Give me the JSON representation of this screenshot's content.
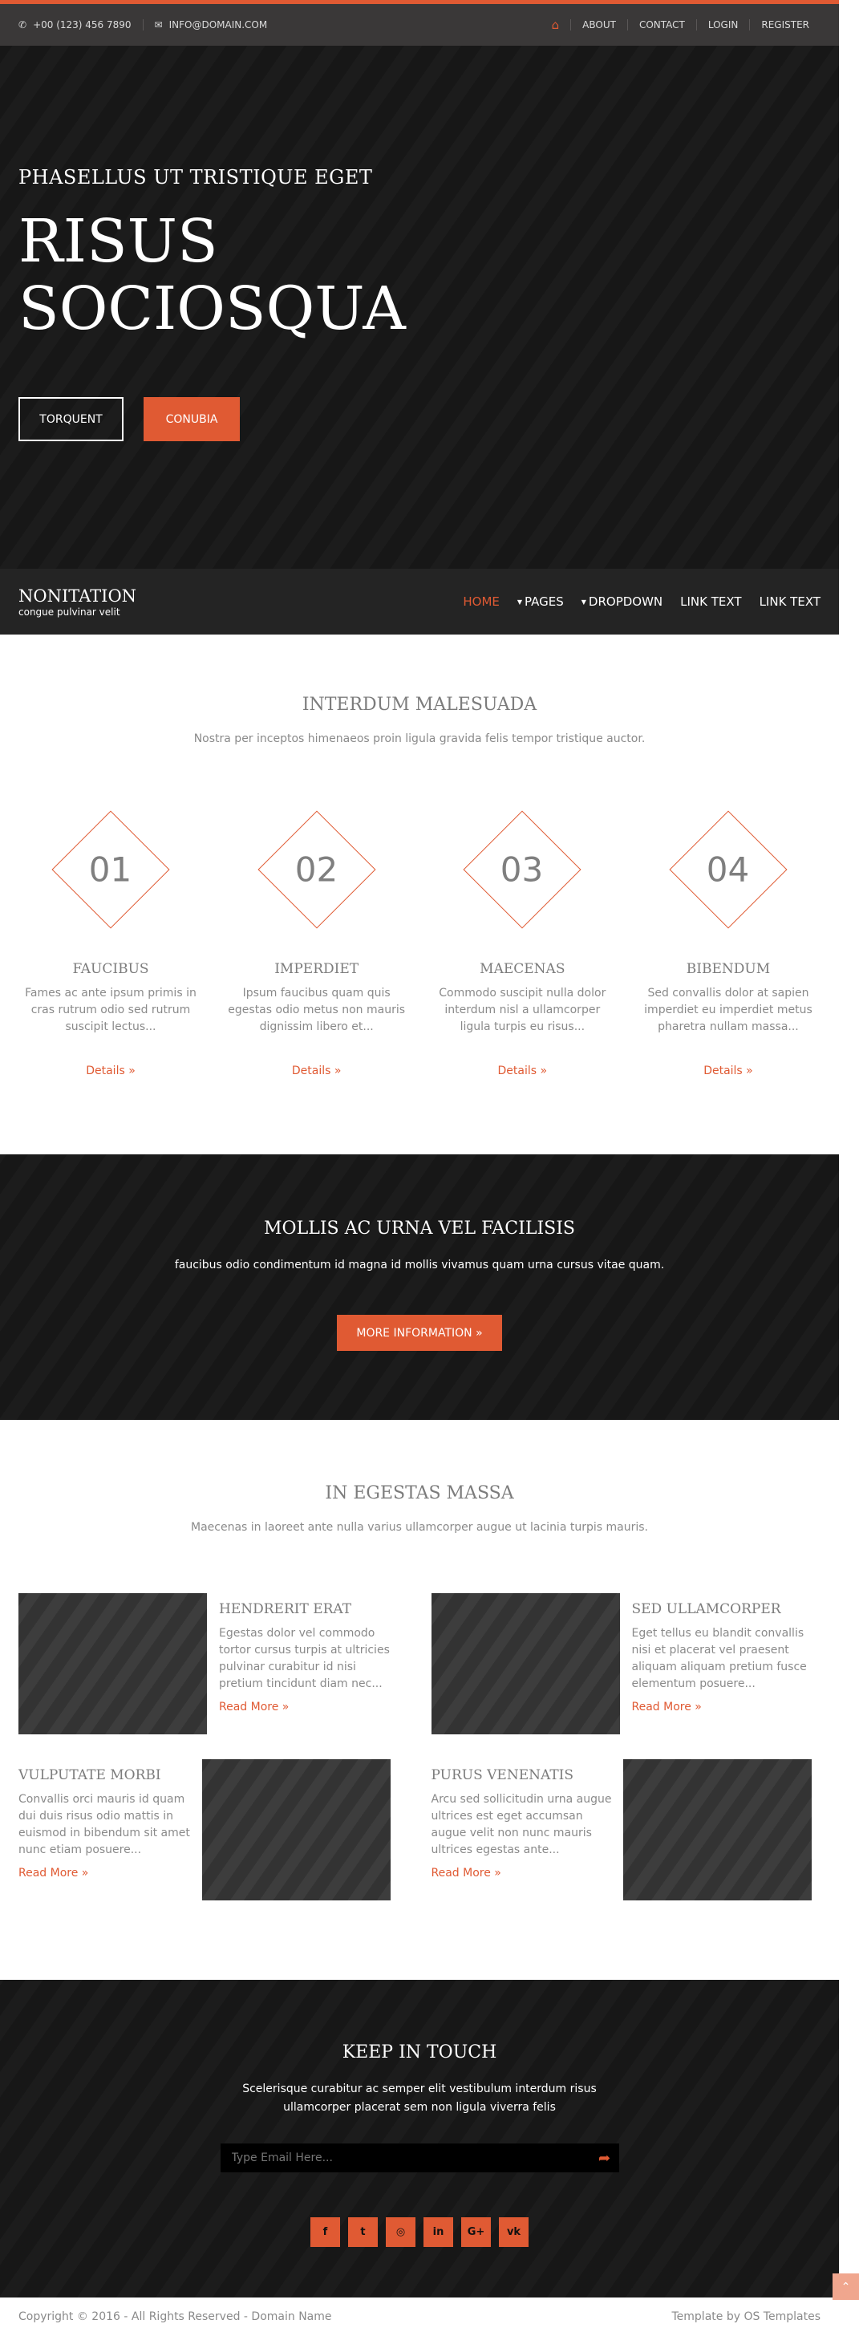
{
  "colors": {
    "accent": "#e05a33",
    "dark": "#171717",
    "topbar": "#3a3838",
    "navbar": "#242424"
  },
  "topbar": {
    "phone_icon": "phone-icon",
    "phone": "+00 (123) 456 7890",
    "email_icon": "envelope-icon",
    "email": "INFO@DOMAIN.COM",
    "home_icon": "home-icon",
    "links": [
      "ABOUT",
      "CONTACT",
      "LOGIN",
      "REGISTER"
    ]
  },
  "hero": {
    "subtitle": "PHASELLUS UT TRISTIQUE EGET",
    "title_line1": "RISUS",
    "title_line2": "SOCIOSQUA",
    "btn_primary": "TORQUENT",
    "btn_secondary": "CONUBIA"
  },
  "navbar": {
    "brand": "NONITATION",
    "tagline": "congue pulvinar velit",
    "items": [
      "HOME",
      "PAGES",
      "DROPDOWN",
      "LINK TEXT",
      "LINK TEXT"
    ]
  },
  "features": {
    "title": "INTERDUM MALESUADA",
    "subtitle": "Nostra per inceptos himenaeos proin ligula gravida felis tempor tristique auctor.",
    "items": [
      {
        "num": "01",
        "title": "FAUCIBUS",
        "l1": "Fames ac ante ipsum primis in",
        "l2": "cras rutrum odio sed rutrum",
        "l3": "suscipit lectus...",
        "link": "Details »"
      },
      {
        "num": "02",
        "title": "IMPERDIET",
        "l1": "Ipsum faucibus quam quis",
        "l2": "egestas odio metus non mauris",
        "l3": "dignissim libero et...",
        "link": "Details »"
      },
      {
        "num": "03",
        "title": "MAECENAS",
        "l1": "Commodo suscipit nulla dolor",
        "l2": "interdum nisl a ullamcorper",
        "l3": "ligula turpis eu risus...",
        "link": "Details »"
      },
      {
        "num": "04",
        "title": "BIBENDUM",
        "l1": "Sed convallis dolor at sapien",
        "l2": "imperdiet eu imperdiet metus",
        "l3": "pharetra nullam massa...",
        "link": "Details »"
      }
    ]
  },
  "cta": {
    "title": "MOLLIS AC URNA VEL FACILISIS",
    "text": "faucibus odio condimentum id magna id mollis vivamus quam urna cursus vitae quam.",
    "button": "MORE INFORMATION »"
  },
  "services": {
    "title": "IN EGESTAS MASSA",
    "subtitle": "Maecenas in laoreet ante nulla varius ullamcorper augue ut lacinia turpis mauris.",
    "items": [
      {
        "title": "HENDRERIT ERAT",
        "l1": "Egestas dolor vel commodo",
        "l2": "tortor cursus turpis at ultricies",
        "l3": "pulvinar curabitur id nisi",
        "l4": "pretium tincidunt diam nec...",
        "link": "Read More »"
      },
      {
        "title": "SED ULLAMCORPER",
        "l1": "Eget tellus eu blandit convallis",
        "l2": "nisi et placerat vel praesent",
        "l3": "aliquam aliquam pretium fusce",
        "l4": "elementum posuere...",
        "link": "Read More »"
      },
      {
        "title": "VULPUTATE MORBI",
        "l1": "Convallis orci mauris id quam",
        "l2": "dui duis risus odio mattis in",
        "l3": "euismod in bibendum sit amet",
        "l4": "nunc etiam posuere...",
        "link": "Read More »"
      },
      {
        "title": "PURUS VENENATIS",
        "l1": "Arcu sed sollicitudin urna augue",
        "l2": "ultrices est eget accumsan",
        "l3": "augue velit non nunc mauris",
        "l4": "ultrices egestas ante...",
        "link": "Read More »"
      }
    ]
  },
  "newsletter": {
    "title": "KEEP IN TOUCH",
    "line1": "Scelerisque curabitur ac semper elit vestibulum interdum risus",
    "line2": "ullamcorper placerat sem non ligula viverra felis",
    "placeholder": "Type Email Here...",
    "socials": [
      "facebook-icon",
      "twitter-icon",
      "dribbble-icon",
      "linkedin-icon",
      "google-plus-icon",
      "vk-icon"
    ]
  },
  "footer": {
    "copyright": "Copyright © 2016 - All Rights Reserved - Domain Name",
    "credit": "Template by OS Templates"
  }
}
